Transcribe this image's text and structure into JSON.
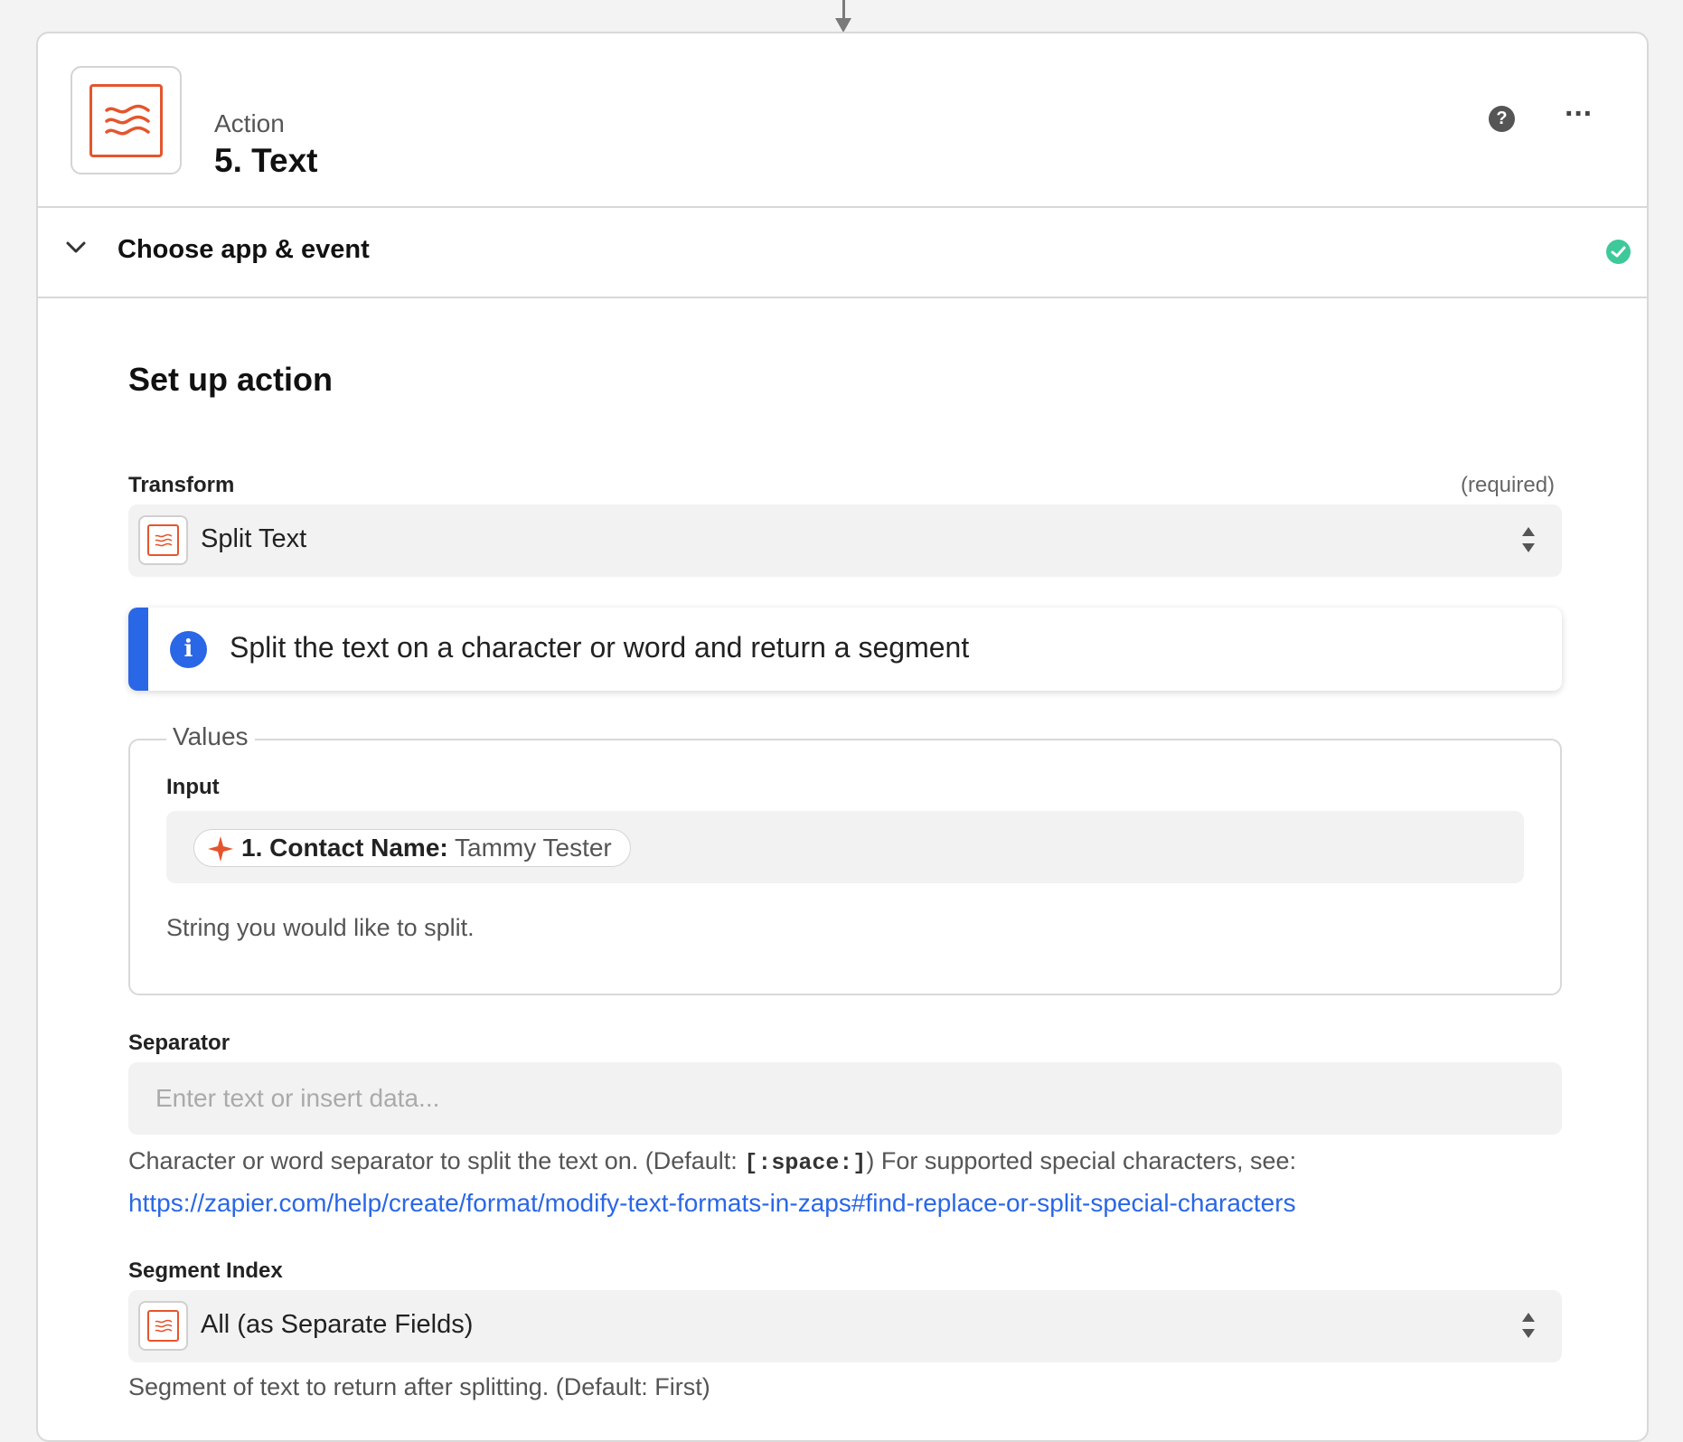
{
  "header": {
    "kind": "Action",
    "title": "5. Text",
    "help_icon": "?",
    "more_icon": "···"
  },
  "section": {
    "title": "Choose app & event"
  },
  "setup": {
    "title": "Set up action",
    "transform": {
      "label": "Transform",
      "required": "(required)",
      "value": "Split Text"
    },
    "info": {
      "text": "Split the text on a character or word and return a segment"
    },
    "values": {
      "legend": "Values",
      "input_label": "Input",
      "pill_key": "1. Contact Name:",
      "pill_value": "Tammy Tester",
      "help": "String you would like to split."
    },
    "separator": {
      "label": "Separator",
      "placeholder": "Enter text or insert data...",
      "help_prefix": "Character or word separator to split the text on. (Default: ",
      "help_code": "[:space:]",
      "help_suffix": ") For supported special characters, see:",
      "link": "https://zapier.com/help/create/format/modify-text-formats-in-zaps#find-replace-or-split-special-characters"
    },
    "segment": {
      "label": "Segment Index",
      "value": "All (as Separate Fields)",
      "help": "Segment of text to return after splitting. (Default: First)"
    }
  },
  "colors": {
    "brand_orange": "#e5552d",
    "info_blue": "#2a67e6",
    "success_green": "#3ec99a"
  }
}
